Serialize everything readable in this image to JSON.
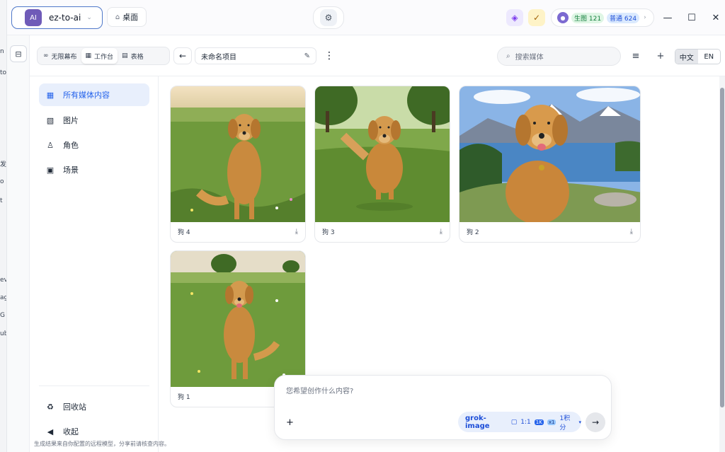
{
  "titlebar": {
    "workspace_avatar": "AI",
    "workspace_name": "ez-to-ai",
    "desktop_label": "桌面",
    "credits": {
      "image_label": "生图 121",
      "general_label": "普通 624"
    }
  },
  "toolbar": {
    "views": [
      {
        "label": "无限幕布",
        "icon": "infinity-icon"
      },
      {
        "label": "工作台",
        "icon": "grid-icon",
        "active": true
      },
      {
        "label": "表格",
        "icon": "table-icon"
      }
    ],
    "project_name": "未命名项目",
    "search_placeholder": "搜索媒体",
    "lang_zh": "中文",
    "lang_en": "EN"
  },
  "sidebar": {
    "items": [
      {
        "label": "所有媒体内容",
        "icon": "grid-icon",
        "active": true
      },
      {
        "label": "图片",
        "icon": "image-icon"
      },
      {
        "label": "角色",
        "icon": "person-icon"
      },
      {
        "label": "场景",
        "icon": "scene-icon"
      }
    ],
    "trash_label": "回收站",
    "collapse_label": "收起"
  },
  "media": [
    {
      "name": "狗 4"
    },
    {
      "name": "狗 3"
    },
    {
      "name": "狗 2"
    },
    {
      "name": "狗 1"
    }
  ],
  "prompt": {
    "placeholder": "您希望创作什么内容?",
    "model": "grok-image",
    "ratio": "1:1",
    "resolution": "1K",
    "count": "x1",
    "cost": "1积分"
  },
  "footer": {
    "disclaimer": "生成结果来自你配置的远程模型，分享前请核查内容。"
  },
  "background_fragments": [
    "n",
    "to",
    "发",
    "o",
    "t",
    "ev",
    "ag",
    "G",
    "ub"
  ],
  "colors": {
    "accent": "#2563eb",
    "workspace": "#6f5bb8",
    "active_nav_bg": "#e8effc"
  }
}
